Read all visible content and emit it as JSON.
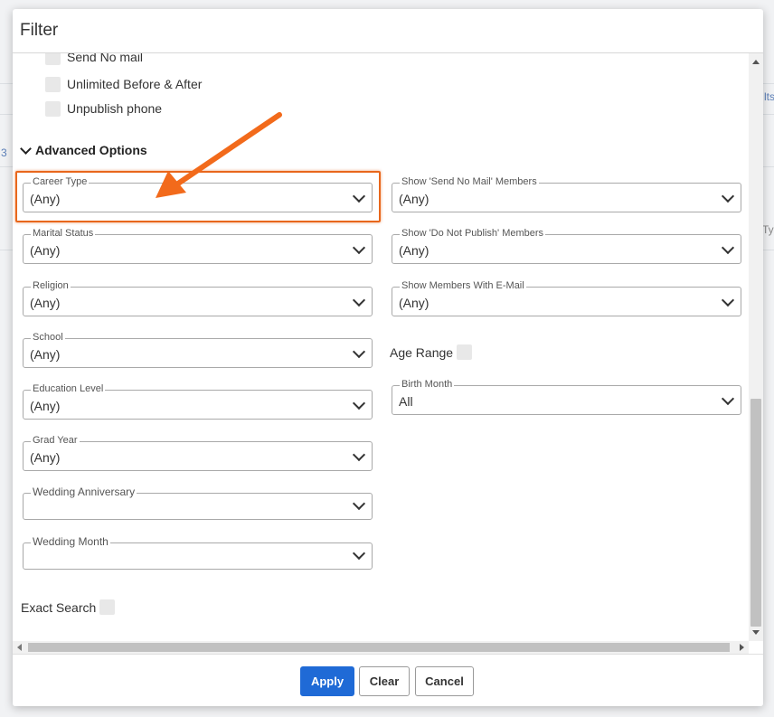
{
  "dialog": {
    "title": "Filter"
  },
  "checkboxes": [
    {
      "label": "Send No mail",
      "checked": false
    },
    {
      "label": "Unlimited Before & After",
      "checked": false
    },
    {
      "label": "Unpublish phone",
      "checked": false
    }
  ],
  "advanced": {
    "label": "Advanced Options"
  },
  "fields_left": [
    {
      "label": "Career Type",
      "value": "(Any)"
    },
    {
      "label": "Marital Status",
      "value": "(Any)"
    },
    {
      "label": "Religion",
      "value": "(Any)"
    },
    {
      "label": "School",
      "value": "(Any)"
    },
    {
      "label": "Education Level",
      "value": "(Any)"
    },
    {
      "label": "Grad Year",
      "value": "(Any)"
    },
    {
      "label": "Wedding Anniversary",
      "value": ""
    },
    {
      "label": "Wedding Month",
      "value": ""
    }
  ],
  "fields_right": [
    {
      "label": "Show 'Send No Mail' Members",
      "value": "(Any)"
    },
    {
      "label": "Show 'Do Not Publish' Members",
      "value": "(Any)"
    },
    {
      "label": "Show Members With E-Mail",
      "value": "(Any)"
    },
    {
      "label": "Birth Month",
      "value": "All"
    }
  ],
  "age_range": {
    "label": "Age Range",
    "checked": false
  },
  "exact_search": {
    "label": "Exact Search",
    "checked": false
  },
  "footer": {
    "apply": "Apply",
    "clear": "Clear",
    "cancel": "Cancel"
  },
  "background": {
    "right_text_1": "lts",
    "right_text_2": "Typ",
    "left_text": "3"
  },
  "colors": {
    "primary": "#1f6ad6",
    "highlight": "#e8671c"
  }
}
